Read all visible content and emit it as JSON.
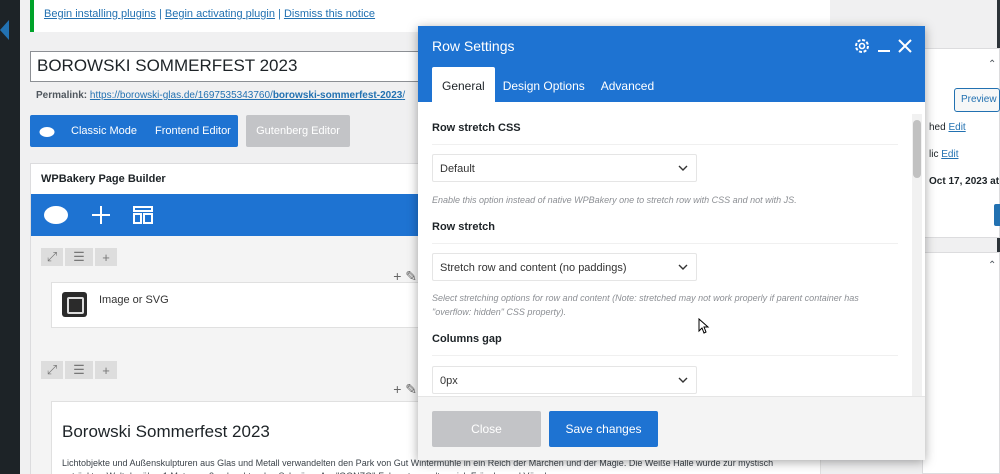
{
  "notice": {
    "link_install": "Begin installing plugins",
    "sep1": "|",
    "link_activate": "Begin activating plugin",
    "sep2": "|",
    "link_dismiss": "Dismiss this notice"
  },
  "post": {
    "title": "BOROWSKI SOMMERFEST 2023",
    "permalink_label": "Permalink:",
    "permalink_base": "https://borowski-glas.de/1697535343760/",
    "permalink_slug": "borowski-sommerfest-2023",
    "permalink_end": "/"
  },
  "editor_modes": {
    "classic": "Classic Mode",
    "frontend": "Frontend Editor",
    "gutenberg": "Gutenberg Editor"
  },
  "wpbakery": {
    "title": "WPBakery Page Builder",
    "element1_label": "Image or SVG",
    "text_title": "Borowski Sommerfest 2023",
    "text_body": "Lichtobjekte und Außenskulpturen aus Glas und Metall verwandelten den Park von Gut Wintermühle in ein Reich der Märchen und der Magie. Die Weiße Halle wurde zur mystisch entrückten Welt der über 1 Meter großen leuchtenden Schwäne. Am \"GONZO\"-Felsen tummelten sich Frösche und Vögel"
  },
  "sidebar": {
    "preview": "Preview",
    "line1_prefix": "hed",
    "line1_link": "Edit",
    "line2_prefix": "lic",
    "line2_link": "Edit",
    "date": "Oct 17, 2023 at"
  },
  "modal": {
    "title": "Row Settings",
    "tabs": [
      "General",
      "Design Options",
      "Advanced"
    ],
    "fields": [
      {
        "label": "Row stretch CSS",
        "value": "Default",
        "hint": "Enable this option instead of native WPBakery one to stretch row with CSS and not with JS."
      },
      {
        "label": "Row stretch",
        "value": "Stretch row and content (no paddings)",
        "hint": "Select stretching options for row and content (Note: stretched may not work properly if parent container has \"overflow: hidden\" CSS property)."
      },
      {
        "label": "Columns gap",
        "value": "0px",
        "hint": ""
      }
    ],
    "close": "Close",
    "save": "Save changes"
  },
  "colors": {
    "wpb_blue": "#1e73d2",
    "wp_link": "#2271b1",
    "disabled_gray": "#c3c4c7",
    "notice_green": "#00a32a"
  }
}
